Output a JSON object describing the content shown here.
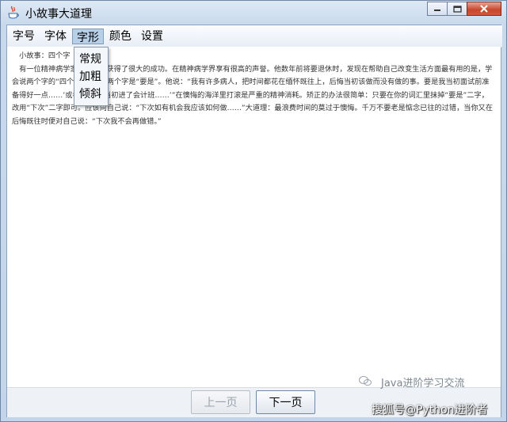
{
  "window": {
    "title": "小故事大道理"
  },
  "menubar": {
    "items": [
      {
        "label": "字号"
      },
      {
        "label": "字体"
      },
      {
        "label": "字形"
      },
      {
        "label": "颜色"
      },
      {
        "label": "设置"
      }
    ]
  },
  "dropdown": {
    "items": [
      {
        "label": "常规"
      },
      {
        "label": "加粗"
      },
      {
        "label": "倾斜"
      }
    ]
  },
  "content": {
    "text": "　小故事：四个字\n　有一位精神病学家，多年，获得了很大的成功。在精神病学界享有很高的声誉。他数年前将要退休时，发现在帮助自己改变生活方面最有用的是，学会说两个字的“四个小字”。头两个字是“要是”。他说：“我有许多病人，把时间都花在缅怀既往上，后悔当初该做而没有做的事。要是我当初面试前准备得好一点……’或者‘要是我当初进了会计班……’”在懊悔的海洋里打滚是严重的精神消耗。矫正的办法很简单：只要在你的词汇里抹掉“要是”二字，改用“下次”二字即可。应该向自己说：“下次如有机会我应该如何做……”大道理：最浪费时间的莫过于懊悔。千万不要老是惦念已往的过错，当你又在后悔既往时便对自己说：“下次我不会再做错。”"
  },
  "buttons": {
    "prev_label": "上一页",
    "next_label": "下一页"
  },
  "watermark": {
    "line1": "Java进阶学习交流",
    "line2": "搜狐号@Python进阶者"
  },
  "colors": {
    "titlebar": "#c8d9ec",
    "close_button": "#c7452c",
    "menu_active": "#b8cfe8"
  }
}
